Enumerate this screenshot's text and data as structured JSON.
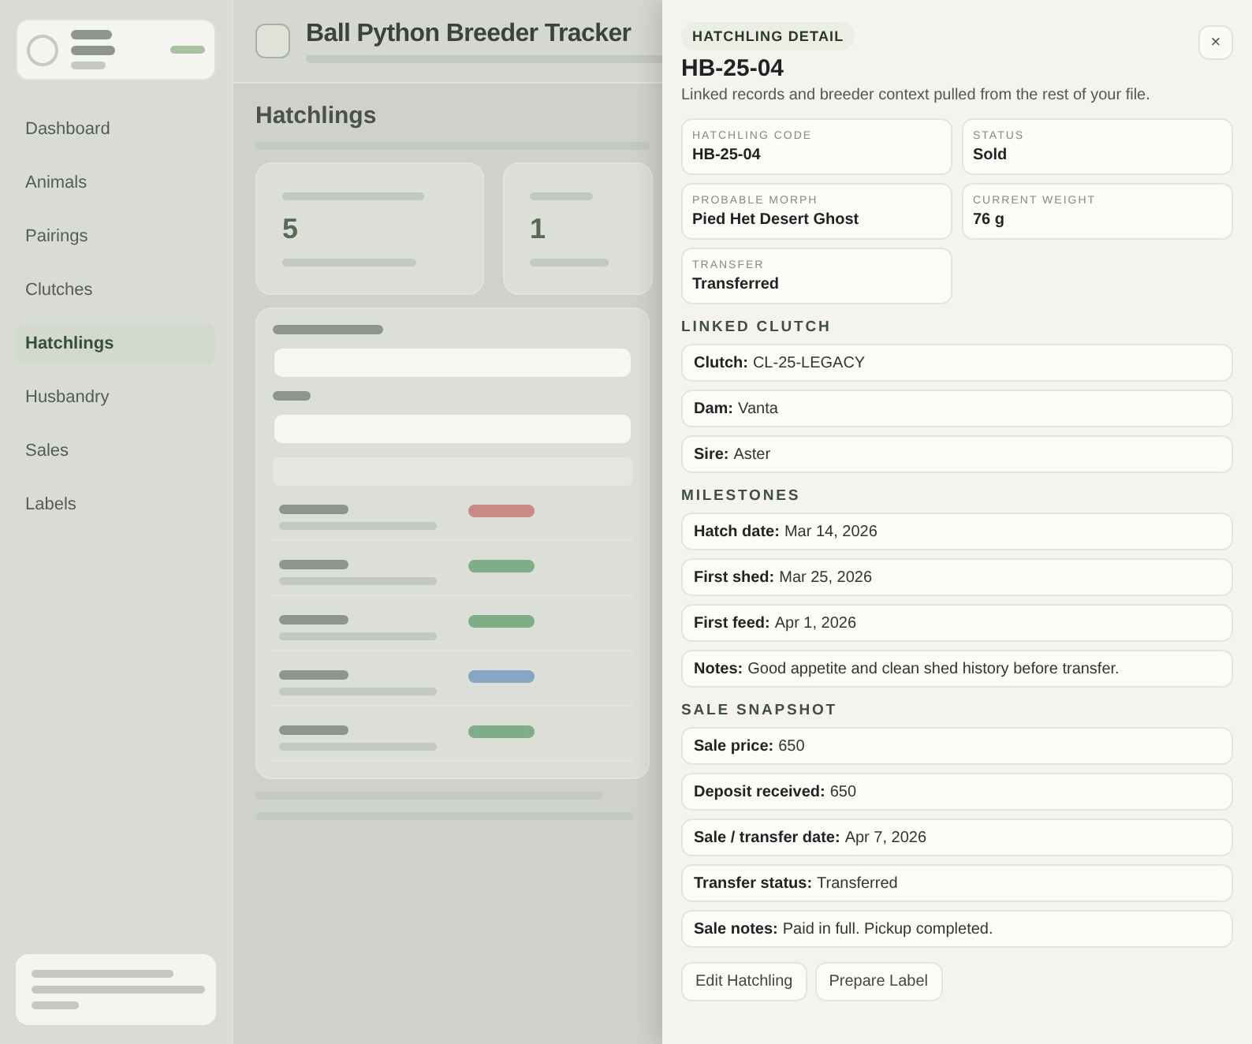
{
  "background": {
    "app_title": "Ball Python Breeder Tracker",
    "page_title": "Hatchlings",
    "nav": [
      {
        "label": "Dashboard",
        "selected": false
      },
      {
        "label": "Animals",
        "selected": false
      },
      {
        "label": "Pairings",
        "selected": false
      },
      {
        "label": "Clutches",
        "selected": false
      },
      {
        "label": "Hatchlings",
        "selected": true
      },
      {
        "label": "Husbandry",
        "selected": false
      },
      {
        "label": "Sales",
        "selected": false
      },
      {
        "label": "Labels",
        "selected": false
      }
    ],
    "stats": [
      {
        "value": "5"
      },
      {
        "value": "1"
      }
    ],
    "table_rows": [
      {
        "color": "#c98a86"
      },
      {
        "color": "#7fae86"
      },
      {
        "color": "#7fae86"
      },
      {
        "color": "#86a6c4"
      },
      {
        "color": "#7fae86"
      }
    ]
  },
  "drawer": {
    "eyebrow": "HATCHLING DETAIL",
    "title": "HB-25-04",
    "subtitle": "Linked records and breeder context pulled from the rest of your file.",
    "close": "×",
    "fields": [
      {
        "label": "HATCHLING CODE",
        "value": "HB-25-04"
      },
      {
        "label": "STATUS",
        "value": "Sold"
      },
      {
        "label": "PROBABLE MORPH",
        "value": "Pied Het Desert Ghost"
      },
      {
        "label": "CURRENT WEIGHT",
        "value": "76 g"
      },
      {
        "label": "TRANSFER",
        "value": "Transferred"
      }
    ],
    "sections": [
      {
        "heading": "LINKED CLUTCH",
        "rows": [
          "**Clutch:** CL-25-LEGACY",
          "**Dam:** Vanta",
          "**Sire:** Aster"
        ]
      },
      {
        "heading": "MILESTONES",
        "rows": [
          "**Hatch date:** Mar 14, 2026",
          "**First shed:** Mar 25, 2026",
          "**First feed:** Apr 1, 2026",
          "**Notes:** Good appetite and clean shed history before transfer."
        ]
      },
      {
        "heading": "SALE SNAPSHOT",
        "rows": [
          "**Sale price:** 650",
          "**Deposit received:** 650",
          "**Sale / transfer date:** Apr 7, 2026",
          "**Transfer status:** Transferred",
          "**Sale notes:** Paid in full. Pickup completed."
        ]
      }
    ],
    "buttons": [
      "Edit Hatchling",
      "Prepare Label"
    ]
  }
}
